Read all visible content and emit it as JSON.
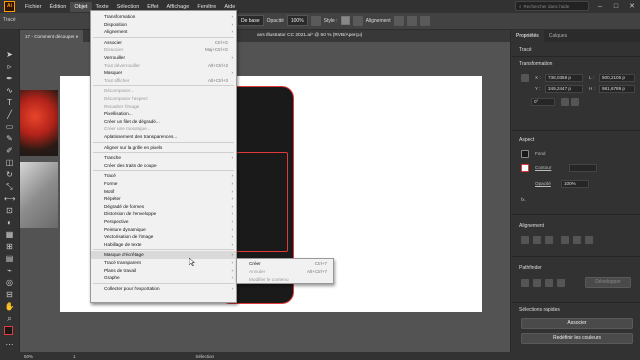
{
  "app": {
    "logo_text": "Ai"
  },
  "menubar": {
    "items": [
      "Fichier",
      "Édition",
      "Objet",
      "Texte",
      "Sélection",
      "Effet",
      "Affichage",
      "Fenêtre",
      "Aide"
    ],
    "search_placeholder": "Rechercher dans l'aide"
  },
  "controlbar": {
    "selection_label": "Tracé",
    "style_preset": "De base",
    "opacity_label": "Opacité",
    "opacity_value": "100%",
    "style_label": "Style :",
    "alignment_label": "Alignement"
  },
  "tabs": {
    "doc_tab": "17 - Comment découper e",
    "doc_tab_rest": "ans Illustrator CC 2021.ai* @ 50 % (RVB/Aperçu)"
  },
  "dropdown": {
    "items": [
      {
        "label": "Transformation",
        "shortcut": "",
        "submenu": true,
        "disabled": false
      },
      {
        "label": "Disposition",
        "shortcut": "",
        "submenu": true,
        "disabled": false
      },
      {
        "label": "Alignement",
        "shortcut": "",
        "submenu": true,
        "disabled": false
      },
      {
        "sep": true
      },
      {
        "label": "Associer",
        "shortcut": "Ctrl+G",
        "submenu": false,
        "disabled": false
      },
      {
        "label": "Dissocier",
        "shortcut": "Maj+Ctrl+G",
        "submenu": false,
        "disabled": true
      },
      {
        "label": "Verrouiller",
        "shortcut": "",
        "submenu": true,
        "disabled": false
      },
      {
        "label": "Tout déverrouiller",
        "shortcut": "Alt+Ctrl+2",
        "submenu": false,
        "disabled": true
      },
      {
        "label": "Masquer",
        "shortcut": "",
        "submenu": true,
        "disabled": false
      },
      {
        "label": "Tout afficher",
        "shortcut": "Alt+Ctrl+3",
        "submenu": false,
        "disabled": true
      },
      {
        "sep": true
      },
      {
        "label": "Décomposer...",
        "shortcut": "",
        "submenu": false,
        "disabled": true
      },
      {
        "label": "Décomposer l'aspect",
        "shortcut": "",
        "submenu": false,
        "disabled": true
      },
      {
        "label": "Recadrer l'image",
        "shortcut": "",
        "submenu": false,
        "disabled": true
      },
      {
        "label": "Pixellisation...",
        "shortcut": "",
        "submenu": false,
        "disabled": false
      },
      {
        "label": "Créer un filet de dégradé...",
        "shortcut": "",
        "submenu": false,
        "disabled": false
      },
      {
        "label": "Créer une mosaïque...",
        "shortcut": "",
        "submenu": false,
        "disabled": true
      },
      {
        "label": "Aplatissement des transparences...",
        "shortcut": "",
        "submenu": false,
        "disabled": false
      },
      {
        "sep": true
      },
      {
        "label": "Aligner sur la grille en pixels",
        "shortcut": "",
        "submenu": false,
        "disabled": false
      },
      {
        "sep": true
      },
      {
        "label": "Tranche",
        "shortcut": "",
        "submenu": true,
        "disabled": false
      },
      {
        "label": "Créer des traits de coupe",
        "shortcut": "",
        "submenu": false,
        "disabled": false
      },
      {
        "sep": true
      },
      {
        "label": "Tracé",
        "shortcut": "",
        "submenu": true,
        "disabled": false
      },
      {
        "label": "Forme",
        "shortcut": "",
        "submenu": true,
        "disabled": false
      },
      {
        "label": "Motif",
        "shortcut": "",
        "submenu": true,
        "disabled": false
      },
      {
        "label": "Répéter",
        "shortcut": "",
        "submenu": true,
        "disabled": false
      },
      {
        "label": "Dégradé de formes",
        "shortcut": "",
        "submenu": true,
        "disabled": false
      },
      {
        "label": "Distorsion de l'enveloppe",
        "shortcut": "",
        "submenu": true,
        "disabled": false
      },
      {
        "label": "Perspective",
        "shortcut": "",
        "submenu": true,
        "disabled": false
      },
      {
        "label": "Peinture dynamique",
        "shortcut": "",
        "submenu": true,
        "disabled": false
      },
      {
        "label": "Vectorisation de l'image",
        "shortcut": "",
        "submenu": true,
        "disabled": false
      },
      {
        "label": "Habillage de texte",
        "shortcut": "",
        "submenu": true,
        "disabled": false
      },
      {
        "sep": true
      },
      {
        "label": "Masque d'écrêtage",
        "shortcut": "",
        "submenu": true,
        "disabled": false,
        "hover": true
      },
      {
        "label": "Tracé transparent",
        "shortcut": "",
        "submenu": true,
        "disabled": false
      },
      {
        "label": "Plans de travail",
        "shortcut": "",
        "submenu": true,
        "disabled": false
      },
      {
        "label": "Graphe",
        "shortcut": "",
        "submenu": true,
        "disabled": false
      },
      {
        "sep": true
      },
      {
        "label": "Collecter pour l'exportation",
        "shortcut": "",
        "submenu": true,
        "disabled": false
      }
    ]
  },
  "submenu": {
    "items": [
      {
        "label": "Créer",
        "shortcut": "Ctrl+7",
        "disabled": false
      },
      {
        "label": "Annuler",
        "shortcut": "Alt+Ctrl+7",
        "disabled": true
      },
      {
        "label": "Modifier le contenu",
        "shortcut": "",
        "disabled": true
      }
    ]
  },
  "panel": {
    "tabs": [
      "Propriétés",
      "Calques"
    ],
    "object_type": "Tracé",
    "transform_title": "Transformation",
    "x_label": "X :",
    "x_value": "738,0358 p",
    "y_label": "Y :",
    "y_value": "349,2447 p",
    "w_label": "L :",
    "w_value": "500,2105 p",
    "h_label": "H :",
    "h_value": "981,6789 p",
    "angle_value": "0°",
    "aspect_title": "Aspect",
    "fill_label": "Fond",
    "stroke_label": "Contour",
    "opacity_label": "Opacité",
    "opacity_value": "100%",
    "align_title": "Alignement",
    "pathfinder_title": "Pathfinder",
    "extend_label": "Développer",
    "quick_actions_title": "Sélections rapides",
    "arrange_button": "Associer",
    "recolor_button": "Redéfinir les couleurs"
  },
  "statusbar": {
    "zoom": "50%",
    "artboard": "1",
    "tool": "Sélection"
  },
  "colors": {
    "menu_bg": "#f1f1f1",
    "hover_bg": "#d9d9d9",
    "brand": "#ff9a00",
    "selection": "#e23a3a"
  }
}
